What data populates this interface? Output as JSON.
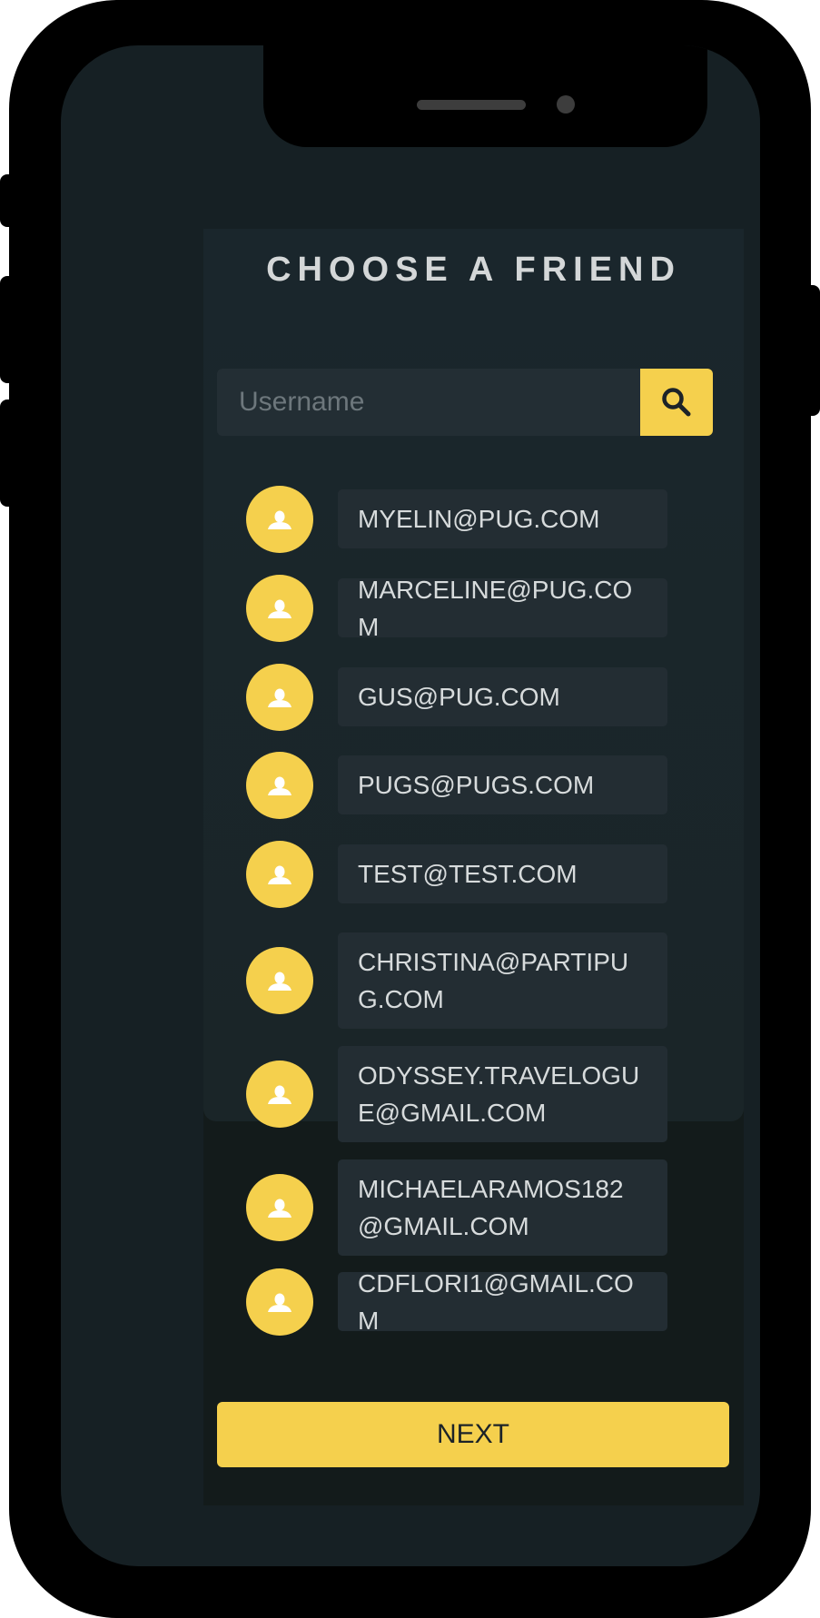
{
  "header": {
    "title": "CHOOSE A FRIEND"
  },
  "search": {
    "placeholder": "Username",
    "button_icon": "search-icon"
  },
  "friends": [
    {
      "email": "MYELIN@PUG.COM"
    },
    {
      "email": "MARCELINE@PUG.COM"
    },
    {
      "email": "GUS@PUG.COM"
    },
    {
      "email": "PUGS@PUGS.COM"
    },
    {
      "email": "TEST@TEST.COM"
    },
    {
      "email": "CHRISTINA@PARTIPUG.COM"
    },
    {
      "email": "ODYSSEY.TRAVELOGUE@GMAIL.COM"
    },
    {
      "email": "MICHAELARAMOS182@GMAIL.COM"
    },
    {
      "email": "CDFLORI1@GMAIL.COM"
    }
  ],
  "footer": {
    "next_label": "NEXT"
  },
  "colors": {
    "accent": "#f5d04d",
    "background": "#162024",
    "card": "#232d33",
    "text": "#d7dbdc"
  },
  "icons": {
    "avatar": "user-avatar-icon",
    "search": "search-icon"
  }
}
